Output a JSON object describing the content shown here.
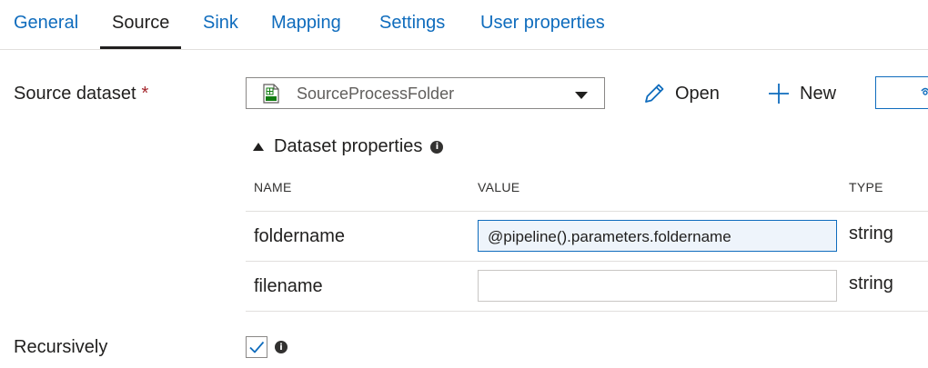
{
  "tabs": {
    "general": "General",
    "source": "Source",
    "sink": "Sink",
    "mapping": "Mapping",
    "settings": "Settings",
    "user_properties": "User properties"
  },
  "source_dataset": {
    "label": "Source dataset",
    "required_mark": "*",
    "selected": "SourceProcessFolder",
    "icon": "csv-file-icon",
    "open_label": "Open",
    "new_label": "New"
  },
  "dataset_properties": {
    "title": "Dataset properties",
    "expanded": true,
    "columns": {
      "name": "NAME",
      "value": "VALUE",
      "type": "TYPE"
    },
    "rows": [
      {
        "name": "foldername",
        "value": "@pipeline().parameters.foldername",
        "type": "string"
      },
      {
        "name": "filename",
        "value": "",
        "type": "string"
      }
    ]
  },
  "recursively": {
    "label": "Recursively",
    "checked": true
  },
  "colors": {
    "accent": "#0f6cbd",
    "required": "#a4262c",
    "text": "#201f1e"
  }
}
